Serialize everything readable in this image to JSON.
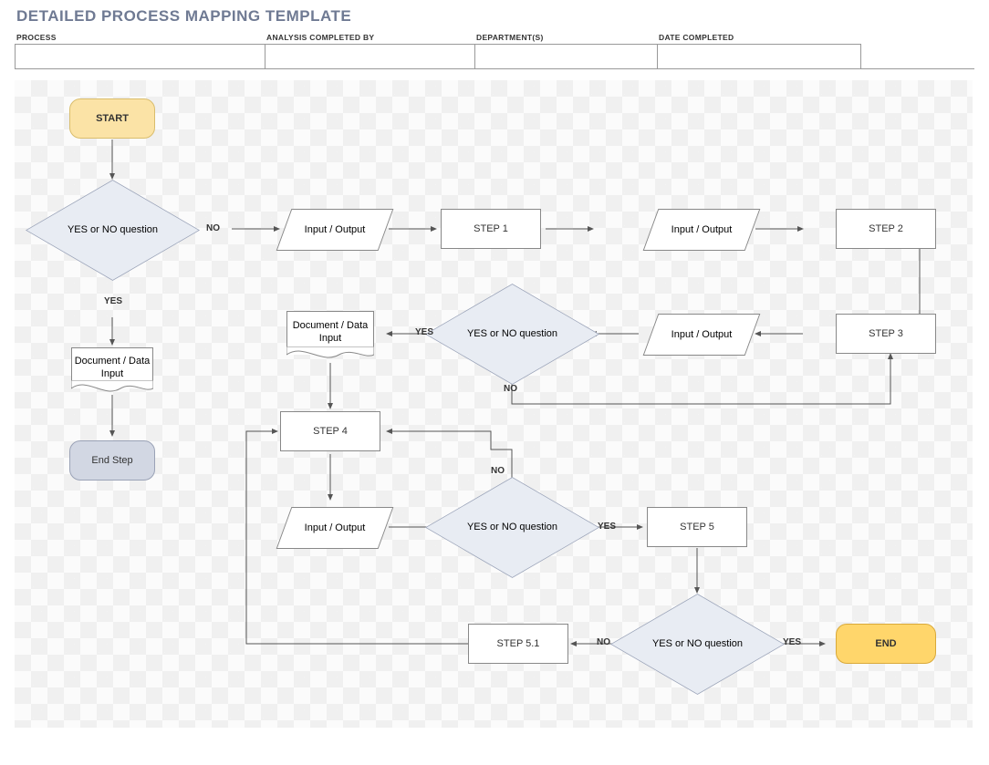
{
  "title": "DETAILED PROCESS MAPPING TEMPLATE",
  "header": {
    "process": "PROCESS",
    "analysis": "ANALYSIS COMPLETED BY",
    "department": "DEPARTMENT(S)",
    "date": "DATE COMPLETED"
  },
  "nodes": {
    "start": "START",
    "q1": "YES or NO question",
    "doc1": "Document / Data Input",
    "endstep": "End Step",
    "io1": "Input / Output",
    "step1": "STEP 1",
    "io2": "Input / Output",
    "step2": "STEP 2",
    "step3": "STEP 3",
    "io3": "Input / Output",
    "q2": "YES or NO question",
    "doc2": "Document / Data Input",
    "step4": "STEP 4",
    "io4": "Input / Output",
    "q3": "YES or NO question",
    "step5": "STEP 5",
    "q4": "YES or NO question",
    "step51": "STEP 5.1",
    "end": "END"
  },
  "labels": {
    "q1_no": "NO",
    "q1_yes": "YES",
    "q2_yes": "YES",
    "q2_no": "NO",
    "q3_no": "NO",
    "q3_yes": "YES",
    "q4_no": "NO",
    "q4_yes": "YES"
  }
}
